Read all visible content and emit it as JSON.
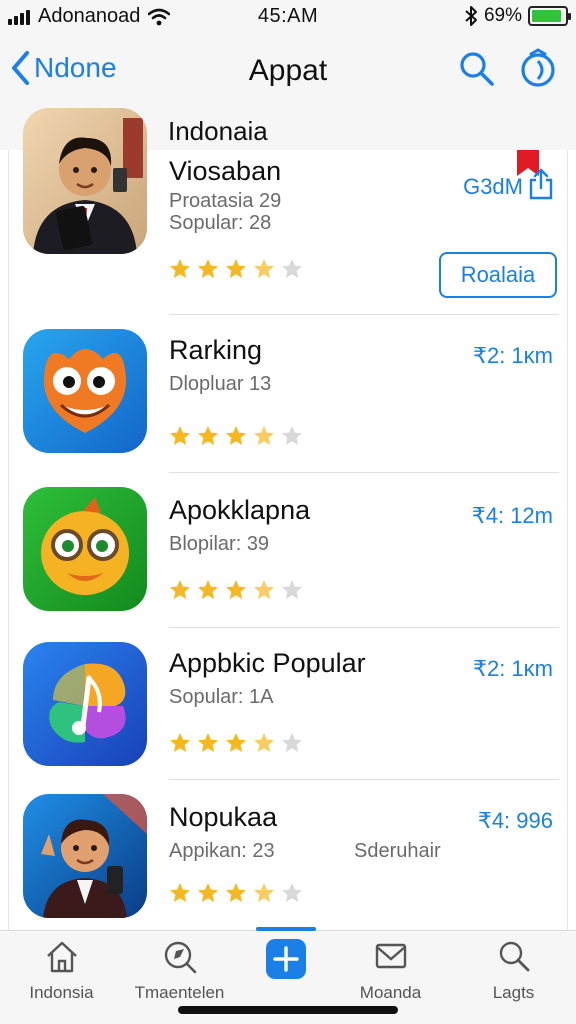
{
  "status_bar": {
    "carrier": "Adonanoad",
    "time": "45:AM",
    "battery_percent": "69%",
    "battery_level": 0.9,
    "icons": [
      "signal-icon",
      "wifi-icon",
      "bluetooth-icon",
      "battery-icon"
    ]
  },
  "nav": {
    "back_label": "Ndone",
    "title": "Appat",
    "section_header": "Indonaia",
    "icons": [
      "back-chevron-icon",
      "search-icon",
      "account-icon"
    ]
  },
  "apps": [
    {
      "name": "Viosaban",
      "subtitle_1": "Proatasia 29",
      "subtitle_2": "Sopular: 28",
      "price": "G3dM",
      "rating": 4,
      "action_label": "Roalaia",
      "icon": "boy-in-suit-icon"
    },
    {
      "name": "Rarking",
      "subtitle_1": "Dlopluar 13",
      "price": "₹2: 1ĸm",
      "rating": 4,
      "icon": "orange-monster-icon"
    },
    {
      "name": "Apokklapna",
      "subtitle_1": "Blopilar: 39",
      "price": "₹4: 12m",
      "rating": 4,
      "icon": "bird-with-glasses-icon"
    },
    {
      "name": "Appbkic Popular",
      "subtitle_1": "Sopular: 1A",
      "price": "₹2: 1ĸm",
      "rating": 4,
      "icon": "colorful-music-note-icon"
    },
    {
      "name": "Nopukaa",
      "subtitle_1": "Appikan: 23",
      "extra": "Sderuhair",
      "price": "₹4: 996",
      "rating": 4,
      "icon": "cartoon-boy-phone-icon"
    }
  ],
  "tabs": [
    {
      "label": "Indonsia",
      "icon": "home-icon"
    },
    {
      "label": "Tmaentelen",
      "icon": "explore-icon"
    },
    {
      "label": "",
      "icon": "add-icon"
    },
    {
      "label": "Moanda",
      "icon": "mail-icon"
    },
    {
      "label": "Lagts",
      "icon": "search-icon"
    }
  ],
  "colors": {
    "accent": "#1a7fe6",
    "star": "#f6b81f",
    "star_empty": "#d9d9d9",
    "battery": "#32c13a"
  }
}
